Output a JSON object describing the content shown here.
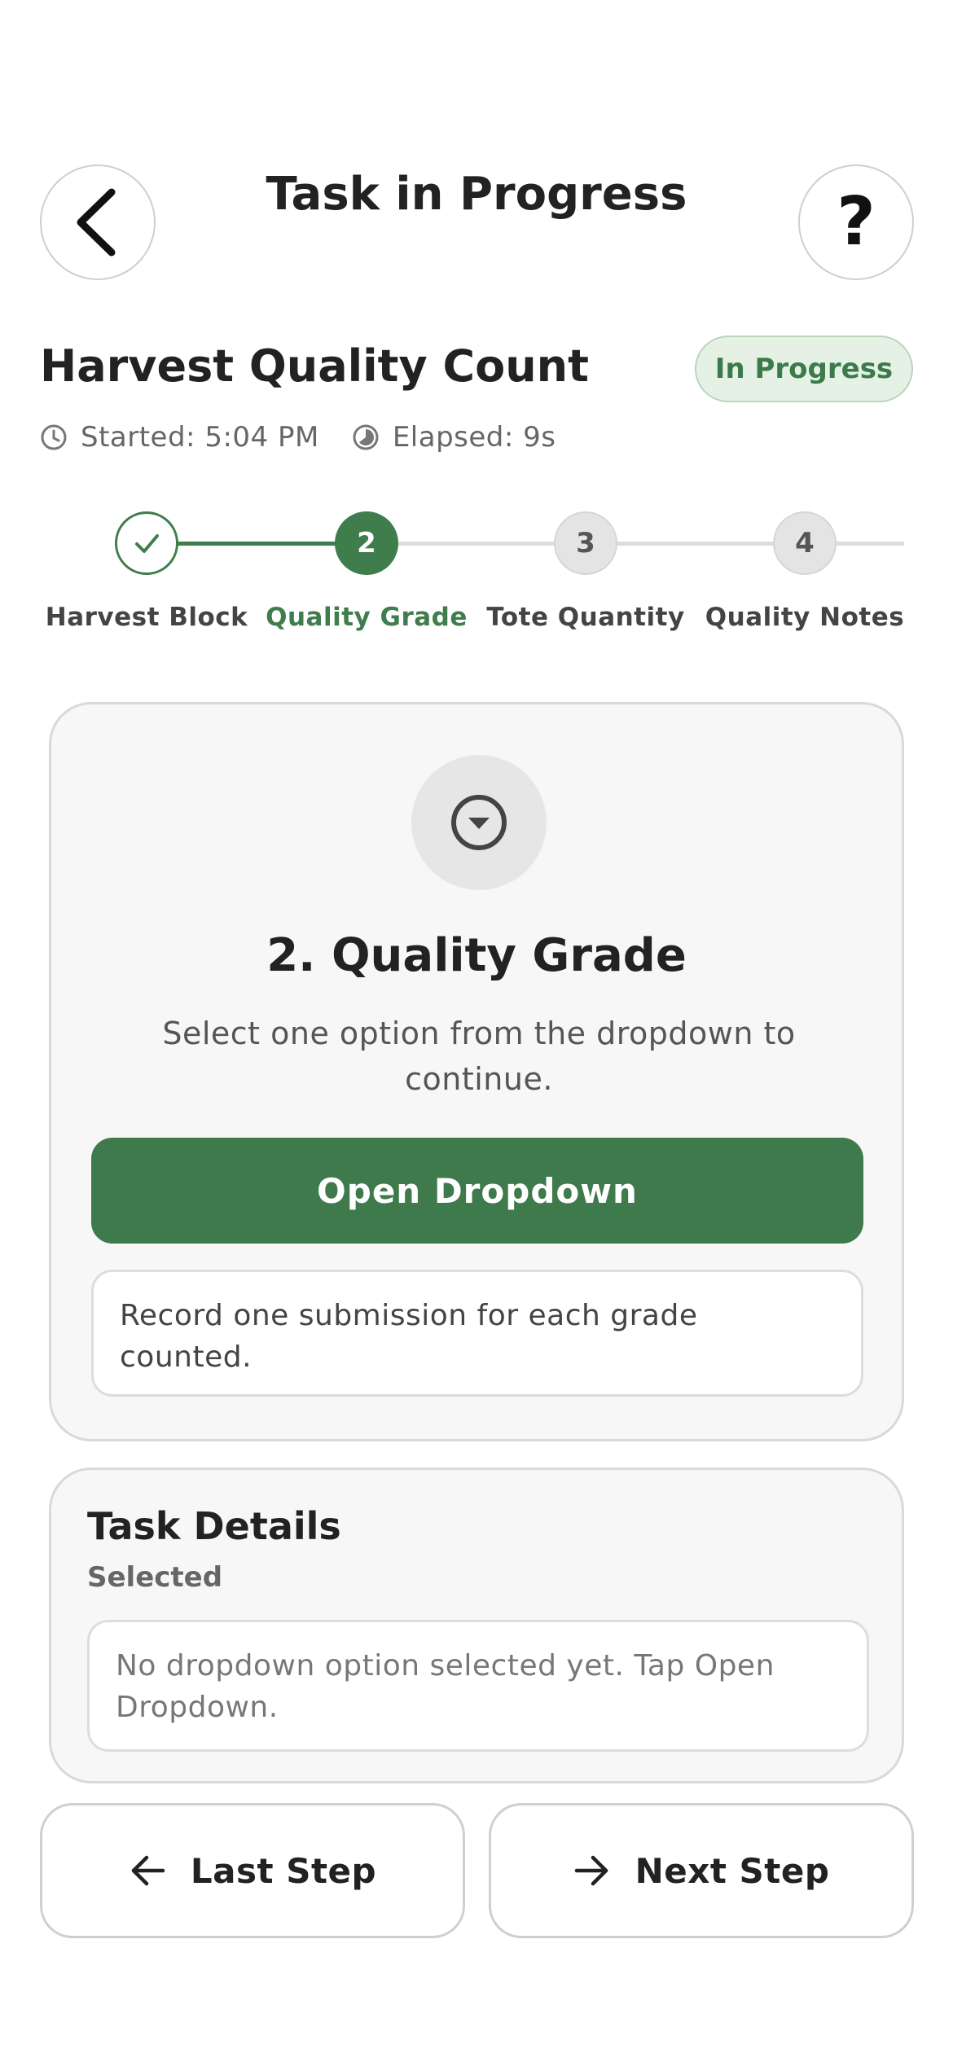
{
  "header": {
    "title": "Task in Progress",
    "back_icon": "chevron-left-icon",
    "help_label": "?"
  },
  "task": {
    "title": "Harvest Quality Count",
    "status": "In Progress",
    "started": "Started: 5:04 PM",
    "elapsed": "Elapsed: 9s"
  },
  "stepper": {
    "steps": [
      {
        "number": "1",
        "label": "Harvest Block",
        "state": "done"
      },
      {
        "number": "2",
        "label": "Quality Grade",
        "state": "active"
      },
      {
        "number": "3",
        "label": "Tote Quantity",
        "state": "pending"
      },
      {
        "number": "4",
        "label": "Quality Notes",
        "state": "pending"
      }
    ]
  },
  "step_card": {
    "icon": "dropdown-circle-icon",
    "title": "2. Quality Grade",
    "subtitle": "Select one option from the dropdown to continue.",
    "button_label": "Open Dropdown",
    "note": "Record one submission for each grade counted."
  },
  "details": {
    "title": "Task Details",
    "label": "Selected",
    "value": "No dropdown option selected yet. Tap Open Dropdown."
  },
  "footer": {
    "prev_label": "Last Step",
    "next_label": "Next Step"
  },
  "colors": {
    "accent": "#3e7a4b",
    "badge_bg": "#e6f1e6",
    "card_bg": "#f7f7f7",
    "pending_dot": "#e4e4e4"
  }
}
